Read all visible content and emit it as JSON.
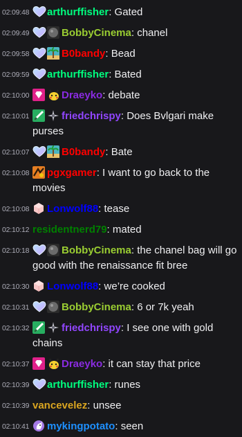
{
  "messages": [
    {
      "ts": "02:09:48",
      "user": "arthurffisher",
      "color": "#00ff7f",
      "badges": [
        "heart-icon"
      ],
      "text": "Gated"
    },
    {
      "ts": "02:09:49",
      "user": "BobbyCinema",
      "color": "#9acd32",
      "badges": [
        "heart-icon",
        "rock-icon"
      ],
      "text": "chanel"
    },
    {
      "ts": "02:09:58",
      "user": "B0bandy",
      "color": "#ff0000",
      "badges": [
        "heart-icon",
        "palm-icon"
      ],
      "text": "Bead"
    },
    {
      "ts": "02:09:59",
      "user": "arthurffisher",
      "color": "#00ff7f",
      "badges": [
        "heart-icon"
      ],
      "text": "Bated"
    },
    {
      "ts": "02:10:00",
      "user": "Draeyko",
      "color": "#8a2be2",
      "badges": [
        "gem-icon",
        "pikachu-icon"
      ],
      "text": "debate"
    },
    {
      "ts": "02:10:01",
      "user": "friedchrispy",
      "color": "#9146ff",
      "badges": [
        "leaf-icon",
        "sparkle-icon"
      ],
      "text": "Does Bvlgari make purses"
    },
    {
      "ts": "02:10:07",
      "user": "B0bandy",
      "color": "#ff0000",
      "badges": [
        "heart-icon",
        "palm-icon"
      ],
      "text": "Bate"
    },
    {
      "ts": "02:10:08",
      "user": "pgxgamer",
      "color": "#ff0000",
      "badges": [
        "gamer-icon"
      ],
      "text": "I want to go back to the movies"
    },
    {
      "ts": "02:10:08",
      "user": "Lonwolf88",
      "color": "#0000ff",
      "badges": [
        "cube-icon"
      ],
      "text": "tease"
    },
    {
      "ts": "02:10:12",
      "user": "residentnerd79",
      "color": "#008000",
      "badges": [],
      "text": "mated"
    },
    {
      "ts": "02:10:18",
      "user": "BobbyCinema",
      "color": "#9acd32",
      "badges": [
        "heart-icon",
        "rock-icon"
      ],
      "text": "the chanel bag will go good with the renaissance fit bree"
    },
    {
      "ts": "02:10:30",
      "user": "Lonwolf88",
      "color": "#0000ff",
      "badges": [
        "cube-icon"
      ],
      "text": "we’re cooked"
    },
    {
      "ts": "02:10:31",
      "user": "BobbyCinema",
      "color": "#9acd32",
      "badges": [
        "heart-icon",
        "rock-icon"
      ],
      "text": "6 or 7k yeah"
    },
    {
      "ts": "02:10:32",
      "user": "friedchrispy",
      "color": "#9146ff",
      "badges": [
        "leaf-icon",
        "sparkle-icon"
      ],
      "text": "I see one with gold chains"
    },
    {
      "ts": "02:10:37",
      "user": "Draeyko",
      "color": "#8a2be2",
      "badges": [
        "gem-icon",
        "pikachu-icon"
      ],
      "text": "it can stay that price"
    },
    {
      "ts": "02:10:39",
      "user": "arthurffisher",
      "color": "#00ff7f",
      "badges": [
        "heart-icon"
      ],
      "text": "runes"
    },
    {
      "ts": "02:10:39",
      "user": "vancevelez",
      "color": "#daa520",
      "badges": [],
      "text": "unsee"
    },
    {
      "ts": "02:10:41",
      "user": "mykingpotato",
      "color": "#1e90ff",
      "badges": [
        "unicorn-icon"
      ],
      "text": "seen"
    }
  ]
}
